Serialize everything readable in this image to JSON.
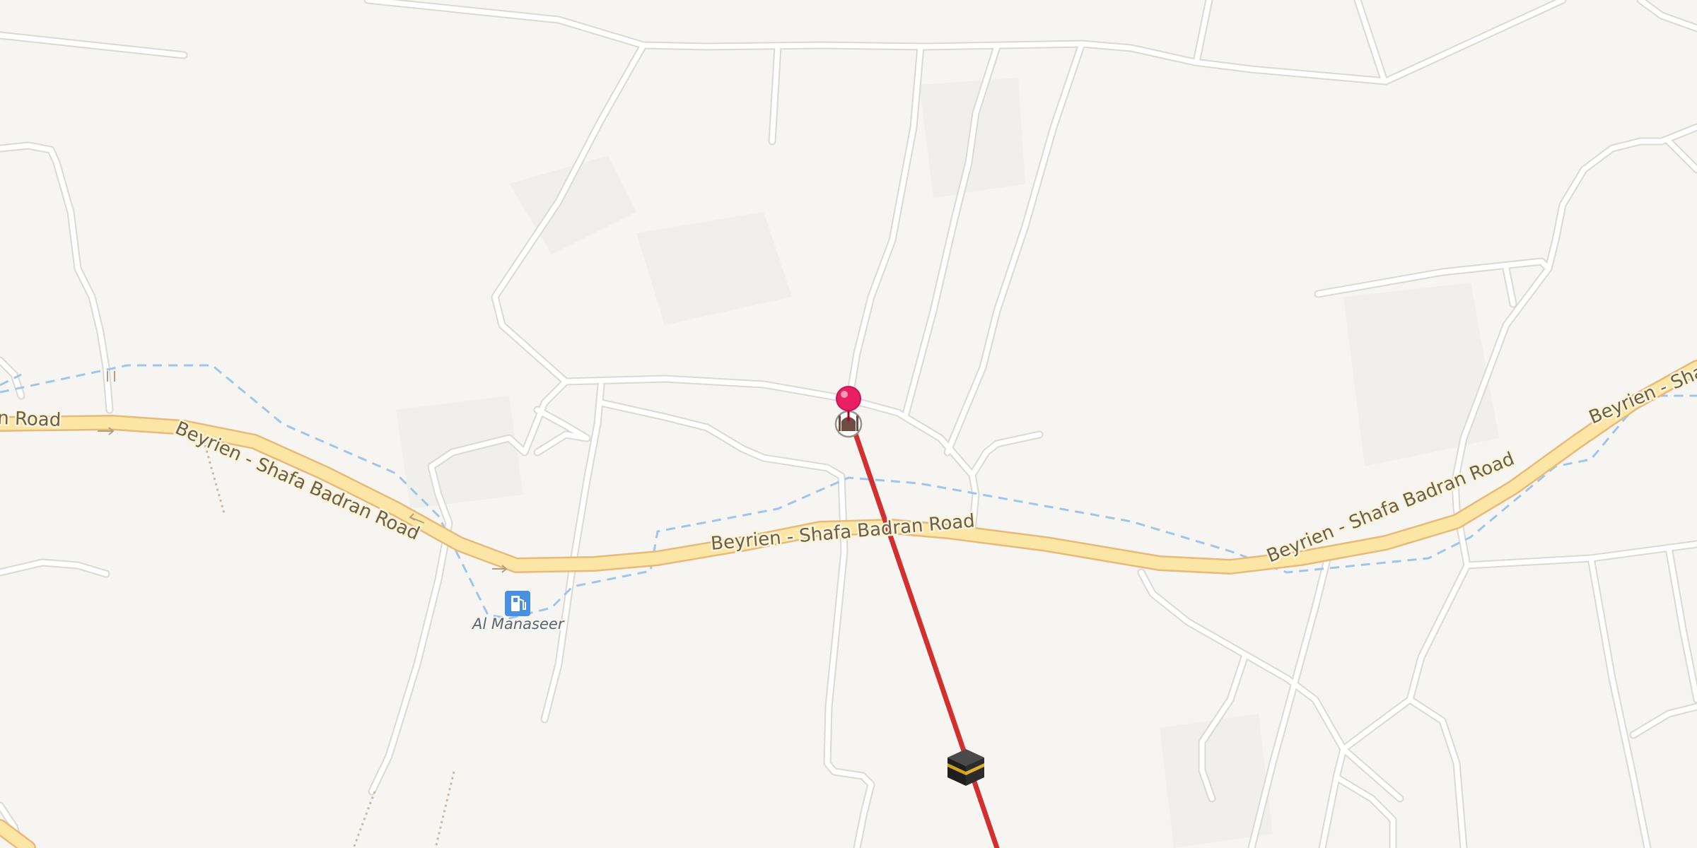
{
  "map": {
    "colors": {
      "background": "#f7f5f2",
      "minor_road": "#ffffff",
      "main_road": "#fce6a6",
      "main_road_casing": "#e8b979",
      "boundary": "#9ec6ec",
      "qibla_line": "#d32f2f",
      "pin": "#e91e63"
    },
    "road_labels": {
      "left_road": "n Road",
      "west_segment": "Beyrien - Shafa Badran Road",
      "center_segment": "Beyrien - Shafa Badran Road",
      "east_segment": "Beyrien - Shafa Badran Road",
      "far_east_segment": "Beyrien - Shafa"
    },
    "pois": {
      "fuel_station": {
        "label": "Al Manaseer",
        "icon": "fuel-station-icon"
      },
      "mosque": {
        "icon": "mosque-icon"
      },
      "kaaba": {
        "icon": "kaaba-icon"
      },
      "location_pin": {
        "icon": "location-pin-icon"
      }
    }
  }
}
